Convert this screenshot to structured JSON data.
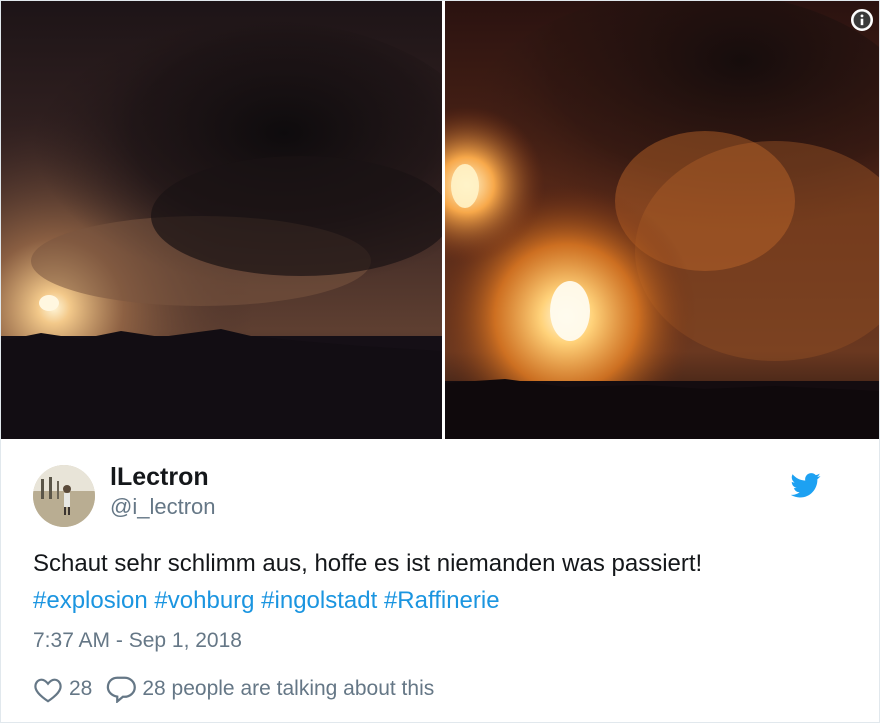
{
  "author": {
    "display_name": "lLectron",
    "handle": "@i_lectron"
  },
  "tweet": {
    "text": "Schaut sehr schlimm aus, hoffe es ist niemanden was passiert!",
    "hashtags": [
      "#explosion",
      "#vohburg",
      "#ingolstadt",
      "#Raffinerie"
    ],
    "timestamp": "7:37 AM - Sep 1, 2018"
  },
  "actions": {
    "like_count": "28",
    "conversation_text": "28 people are talking about this"
  },
  "icons": {
    "info": "info-icon",
    "brand": "twitter-bird-icon",
    "like": "heart-icon",
    "reply": "speech-bubble-icon"
  },
  "colors": {
    "link": "#1b95e0",
    "brand": "#1da1f2",
    "secondary_text": "#657786",
    "primary_text": "#14171a"
  }
}
